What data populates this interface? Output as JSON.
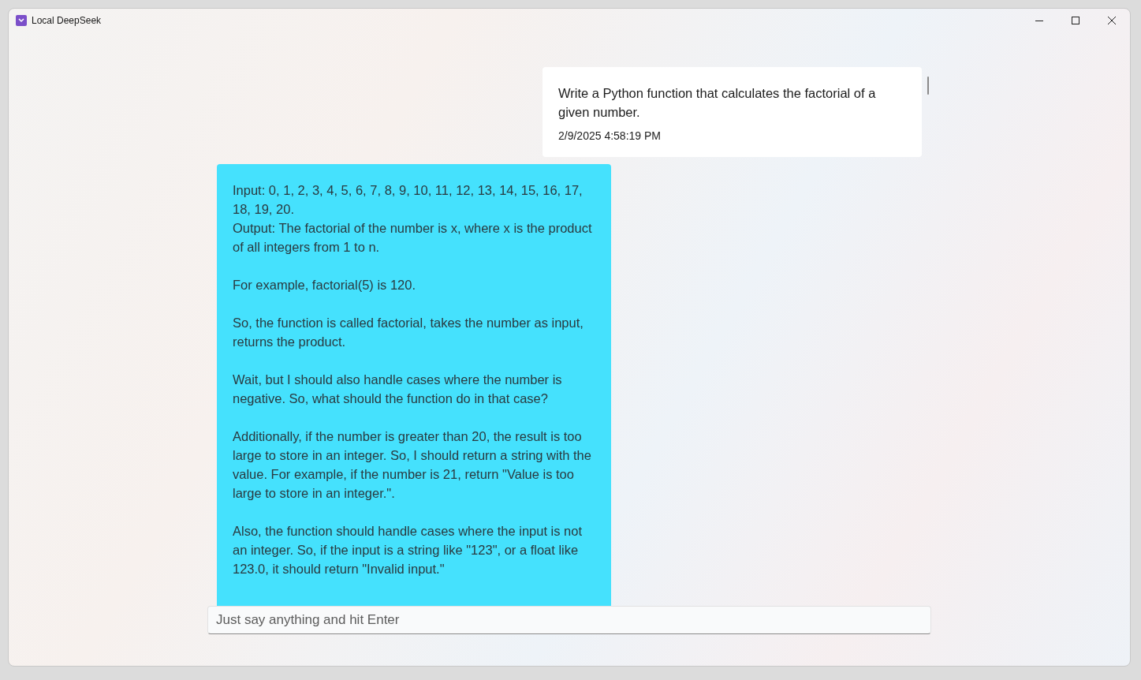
{
  "window": {
    "title": "Local DeepSeek"
  },
  "messages": [
    {
      "kind": "user",
      "paragraphs": [
        "Write a Python function that calculates the factorial of a given number."
      ],
      "time": "2/9/2025 4:58:19 PM"
    },
    {
      "kind": "assistant",
      "paragraphs": [
        "Input: 0, 1, 2, 3, 4, 5, 6, 7, 8, 9, 10, 11, 12, 13, 14, 15, 16, 17, 18, 19, 20.\nOutput: The factorial of the number is x, where x is the product of all integers from 1 to n.",
        "For example, factorial(5) is 120.",
        "So, the function is called factorial, takes the number as input, returns the product.",
        "Wait, but I should also handle cases where the number is negative. So, what should the function do in that case?",
        "Additionally, if the number is greater than 20, the result is too large to store in an integer. So, I should return a string with the value. For example, if the number is 21, return \"Value is too large to store in an integer.\".",
        "Also, the function should handle cases where the input is not an integer. So, if the input is a string like \"123\", or a float like 123.0, it should return \"Invalid input.\""
      ]
    }
  ],
  "input": {
    "placeholder": "Just say anything and hit Enter"
  }
}
